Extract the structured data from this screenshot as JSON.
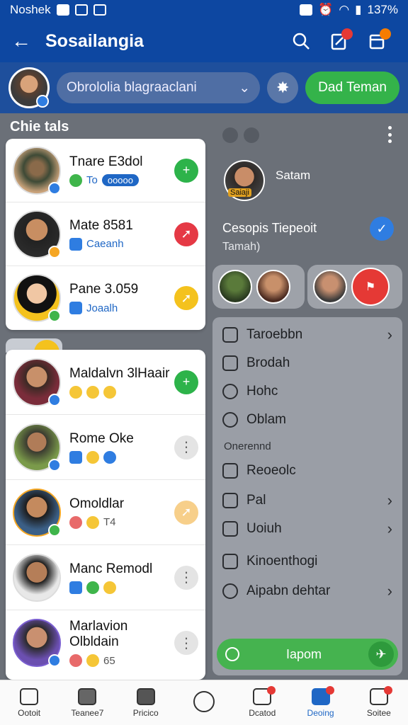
{
  "status_bar": {
    "carrier": "Noshek",
    "battery": "137%"
  },
  "app_bar": {
    "title": "Sosailangia"
  },
  "profile_row": {
    "search_text": "Obrololia blagraaclani",
    "add_button": "Dad Teman"
  },
  "section_title": "Chie tals",
  "contacts_top": [
    {
      "name": "Tnare  E3dol",
      "sub": "To",
      "pill": "ooooo",
      "action": "green"
    },
    {
      "name": "Mate  8581",
      "sub": "Caeanh",
      "action": "red"
    },
    {
      "name": "Pane  3.059",
      "sub": "Joaalh",
      "action": "yellow"
    }
  ],
  "contacts_bottom": [
    {
      "name": "Maldalvn 3lHaair",
      "action": "green"
    },
    {
      "name": "Rome Oke",
      "action": "grey"
    },
    {
      "name": "Omoldlar",
      "sub": "T4",
      "action": "peach"
    },
    {
      "name": "Manc Remodl",
      "action": "grey"
    },
    {
      "name": "Marlavion Olbldain",
      "sub": "65",
      "action": "grey"
    }
  ],
  "right_panel": {
    "user_name": "Satam",
    "user_avatar_label": "Saiaji",
    "status_title": "Cesopis Tiepeoit",
    "status_sub": "Tamah)"
  },
  "menu": {
    "items": [
      {
        "label": "Taroebbn",
        "chevron": true
      },
      {
        "label": "Brodah",
        "chevron": false
      },
      {
        "label": "Hohc",
        "chevron": false
      },
      {
        "label": "Oblam",
        "chevron": false
      }
    ],
    "subheader": "Onerennd",
    "items2": [
      {
        "label": "Reoeolc",
        "chevron": false
      },
      {
        "label": "Pal",
        "chevron": true
      },
      {
        "label": "Uoiuh",
        "chevron": true
      },
      {
        "label": "Kinoenthogi",
        "chevron": false
      },
      {
        "label": "Aipabn dehtar",
        "chevron": true
      }
    ],
    "report_button": "Iapom"
  },
  "bottom_nav": [
    {
      "label": "Ootoit"
    },
    {
      "label": "Teanee7"
    },
    {
      "label": "Pricico"
    },
    {
      "label": ""
    },
    {
      "label": "Dcatod"
    },
    {
      "label": "Deoing"
    },
    {
      "label": "Soitee"
    }
  ],
  "colors": {
    "primary": "#0d47a1",
    "accent_green": "#34b34a",
    "accent_red": "#e53945",
    "accent_yellow": "#f4c21d",
    "link_blue": "#1f67c5"
  }
}
